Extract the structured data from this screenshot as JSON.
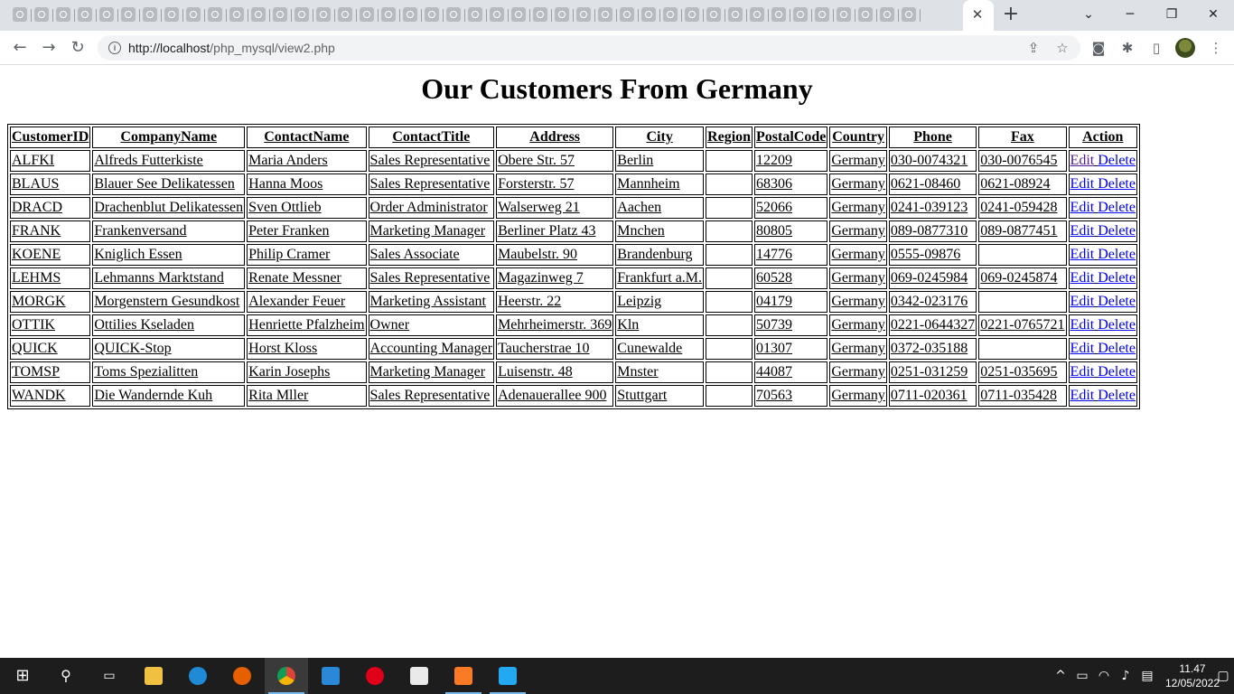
{
  "browser": {
    "url_host": "http://localhost",
    "url_path": "/php_mysql/view2.php",
    "tab_close_glyph": "✕",
    "new_tab_glyph": "+"
  },
  "page": {
    "title": "Our Customers From Germany"
  },
  "table": {
    "headers": [
      "CustomerID",
      "CompanyName",
      "ContactName",
      "ContactTitle",
      "Address",
      "City",
      "Region",
      "PostalCode",
      "Country",
      "Phone",
      "Fax",
      "Action"
    ],
    "edit_label": "Edit",
    "delete_label": "Delete",
    "rows": [
      {
        "id": "ALFKI",
        "company": "Alfreds Futterkiste",
        "contact": "Maria Anders",
        "title": "Sales Representative",
        "address": "Obere Str. 57",
        "city": "Berlin",
        "region": "",
        "postal": "12209",
        "country": "Germany",
        "phone": "030-0074321",
        "fax": "030-0076545"
      },
      {
        "id": "BLAUS",
        "company": "Blauer See Delikatessen",
        "contact": "Hanna Moos",
        "title": "Sales Representative",
        "address": "Forsterstr. 57",
        "city": "Mannheim",
        "region": "",
        "postal": "68306",
        "country": "Germany",
        "phone": "0621-08460",
        "fax": "0621-08924"
      },
      {
        "id": "DRACD",
        "company": "Drachenblut Delikatessen",
        "contact": "Sven Ottlieb",
        "title": "Order Administrator",
        "address": "Walserweg 21",
        "city": "Aachen",
        "region": "",
        "postal": "52066",
        "country": "Germany",
        "phone": "0241-039123",
        "fax": "0241-059428"
      },
      {
        "id": "FRANK",
        "company": "Frankenversand",
        "contact": "Peter Franken",
        "title": "Marketing Manager",
        "address": "Berliner Platz 43",
        "city": "Mnchen",
        "region": "",
        "postal": "80805",
        "country": "Germany",
        "phone": "089-0877310",
        "fax": "089-0877451"
      },
      {
        "id": "KOENE",
        "company": "Kniglich Essen",
        "contact": "Philip Cramer",
        "title": "Sales Associate",
        "address": "Maubelstr. 90",
        "city": "Brandenburg",
        "region": "",
        "postal": "14776",
        "country": "Germany",
        "phone": "0555-09876",
        "fax": ""
      },
      {
        "id": "LEHMS",
        "company": "Lehmanns Marktstand",
        "contact": "Renate Messner",
        "title": "Sales Representative",
        "address": "Magazinweg 7",
        "city": "Frankfurt a.M.",
        "region": "",
        "postal": "60528",
        "country": "Germany",
        "phone": "069-0245984",
        "fax": "069-0245874"
      },
      {
        "id": "MORGK",
        "company": "Morgenstern Gesundkost",
        "contact": "Alexander Feuer",
        "title": "Marketing Assistant",
        "address": "Heerstr. 22",
        "city": "Leipzig",
        "region": "",
        "postal": "04179",
        "country": "Germany",
        "phone": "0342-023176",
        "fax": ""
      },
      {
        "id": "OTTIK",
        "company": "Ottilies Kseladen",
        "contact": "Henriette Pfalzheim",
        "title": "Owner",
        "address": "Mehrheimerstr. 369",
        "city": "Kln",
        "region": "",
        "postal": "50739",
        "country": "Germany",
        "phone": "0221-0644327",
        "fax": "0221-0765721"
      },
      {
        "id": "QUICK",
        "company": "QUICK-Stop",
        "contact": "Horst Kloss",
        "title": "Accounting Manager",
        "address": "Taucherstrae 10",
        "city": "Cunewalde",
        "region": "",
        "postal": "01307",
        "country": "Germany",
        "phone": "0372-035188",
        "fax": ""
      },
      {
        "id": "TOMSP",
        "company": "Toms Spezialitten",
        "contact": "Karin Josephs",
        "title": "Marketing Manager",
        "address": "Luisenstr. 48",
        "city": "Mnster",
        "region": "",
        "postal": "44087",
        "country": "Germany",
        "phone": "0251-031259",
        "fax": "0251-035695"
      },
      {
        "id": "WANDK",
        "company": "Die Wandernde Kuh",
        "contact": "Rita Mller",
        "title": "Sales Representative",
        "address": "Adenauerallee 900",
        "city": "Stuttgart",
        "region": "",
        "postal": "70563",
        "country": "Germany",
        "phone": "0711-020361",
        "fax": "0711-035428"
      }
    ]
  },
  "taskbar": {
    "time": "11.47",
    "date": "12/05/2022"
  }
}
